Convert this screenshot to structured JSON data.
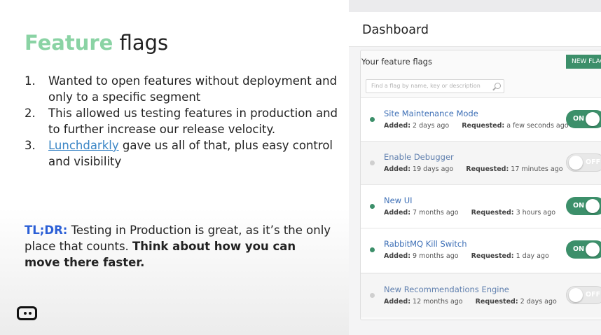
{
  "slide": {
    "title_accent": "Feature",
    "title_rest": "flags",
    "points": [
      {
        "num": "1.",
        "text": "Wanted to open features without deployment and only to a specific segment"
      },
      {
        "num": "2.",
        "text": "This allowed us testing features in production and to further increase our release velocity."
      },
      {
        "num": "3.",
        "link": "Lunchdarkly",
        "text": " gave us all of that, plus easy control and visibility"
      }
    ],
    "tldr": {
      "tag": "TL;DR:",
      "text": " Testing in Production is great, as it’s the only place that counts. ",
      "bold": "Think about how you can move there faster."
    },
    "logo_icon": "robot-face-icon"
  },
  "dashboard": {
    "title": "Dashboard",
    "panel_title": "Your feature flags",
    "new_flag_label": "NEW FLAG",
    "search_placeholder": "Find a flag by name, key or description",
    "search_icon": "search-icon",
    "added_label": "Added:",
    "requested_label": "Requested:",
    "colors": {
      "on": "#3c8f6a",
      "off": "#e8e8e8",
      "dot_on": "#3c8f6a",
      "dot_off": "#cfcfcf"
    },
    "flags": [
      {
        "name": "Site Maintenance Mode",
        "added": "2 days ago",
        "requested": "a few seconds ago",
        "state": "ON"
      },
      {
        "name": "Enable Debugger",
        "added": "19 days ago",
        "requested": "17 minutes ago",
        "state": "OFF"
      },
      {
        "name": "New UI",
        "added": "7 months ago",
        "requested": "3 hours ago",
        "state": "ON"
      },
      {
        "name": "RabbitMQ Kill Switch",
        "added": "9 months ago",
        "requested": "1 day ago",
        "state": "ON"
      },
      {
        "name": "New Recommendations Engine",
        "added": "12 months ago",
        "requested": "2 days ago",
        "state": "OFF"
      }
    ]
  }
}
